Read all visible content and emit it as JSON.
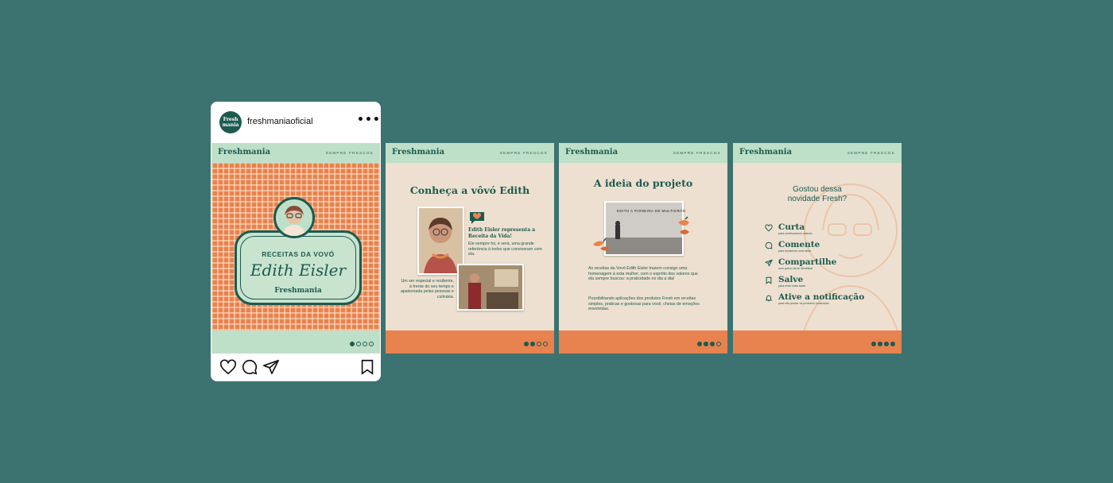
{
  "colors": {
    "background": "#3c7270",
    "brand_green": "#1d5a4f",
    "mint": "#bfe0c8",
    "cream": "#ede0d0",
    "orange": "#e8824f"
  },
  "post": {
    "account": {
      "avatar_text": "Fresh mania",
      "username": "freshmaniaoficial"
    },
    "more_icon": "more-horizontal-icon",
    "actions": {
      "like": "heart-icon",
      "comment": "comment-icon",
      "share": "send-icon",
      "save": "bookmark-icon"
    }
  },
  "slides": [
    {
      "brand": "Freshmania",
      "tagline": "SEMPRE FRESCOS",
      "subtitle": "RECEITAS DA VOVÓ",
      "name": "Edith Eisler",
      "footer_brand": "Freshmania",
      "active_dot": 1,
      "dot_count": 4
    },
    {
      "brand": "Freshmania",
      "tagline": "SEMPRE FRESCOS",
      "title": "Conheça a vôvó Edith",
      "highlight": "Edith Eisler representa a Receita da Vida!",
      "text1": "Ele sempre foi, e será, uma grande referência à todos que conviveram com ela.",
      "text2": "Um ser especial e resiliente, à frente do seu tempo e apaixonada pelas pessoas e culinária.",
      "active_dot": 2,
      "dot_count": 4
    },
    {
      "brand": "Freshmania",
      "tagline": "SEMPRE FRESCOS",
      "title": "A ideia do projeto",
      "photo_caption": "EDITH A PIONEIRA DE MULTIGRÃO",
      "text1": "As receitas da Vovó Edith Eisler trazem consigo uma homenagem à esta mulher, com o espírito dos valores que ela sempre buscou: a praticidade no dia a dia!",
      "text2": "Possibilitando aplicações dos produtos Fresh em receitas simples, práticas e gostosas para você, cheias de emoções envolvidas.",
      "active_dot": 3,
      "dot_count": 4
    },
    {
      "brand": "Freshmania",
      "tagline": "SEMPRE FRESCOS",
      "title_line1": "Gostou dessa",
      "title_line2": "novidade Fresh?",
      "items": [
        {
          "label": "Curta",
          "sub": "para continuarmos criando",
          "icon": "heart-icon"
        },
        {
          "label": "Comente",
          "sub": "para trocarmos uma ideia",
          "icon": "comment-icon"
        },
        {
          "label": "Compartilhe",
          "sub": "com quem vai se identificar",
          "icon": "send-icon"
        },
        {
          "label": "Salve",
          "sub": "para rever mais tarde",
          "icon": "bookmark-icon"
        },
        {
          "label": "Ative a notificação",
          "sub": "para não perder os próximos conteúdos",
          "icon": "bell-icon"
        }
      ],
      "active_dot": 4,
      "dot_count": 4
    }
  ]
}
